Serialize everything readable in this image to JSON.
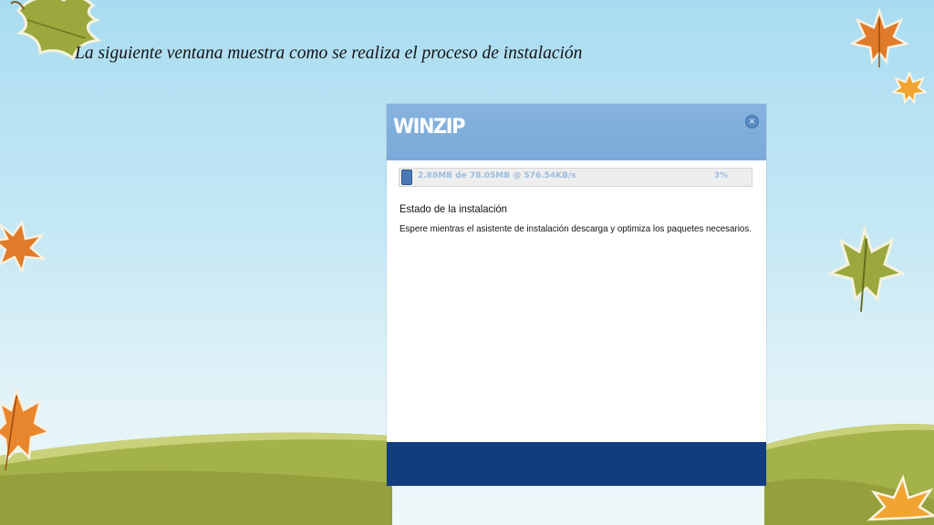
{
  "slide": {
    "title": "La siguiente  ventana muestra como se realiza el proceso de instalación"
  },
  "installer": {
    "logo": "WINZIP",
    "close_glyph": "×",
    "progress": {
      "text": "2.88MB de 78.05MB @ 576.54KB/s",
      "percent_label": "3%",
      "fraction": 0.03
    },
    "status_heading": "Estado de la instalación",
    "status_text": "Espere mientras el asistente de instalación descarga y optimiza los paquetes necesarios."
  },
  "colors": {
    "header": "#7aaad8",
    "footer": "#113c7d",
    "progress_fill": "#4b78b6",
    "sky": "#a9dcf1",
    "hill": "#a9b34f"
  },
  "icons": [
    "close-icon",
    "leaf-decoration"
  ]
}
